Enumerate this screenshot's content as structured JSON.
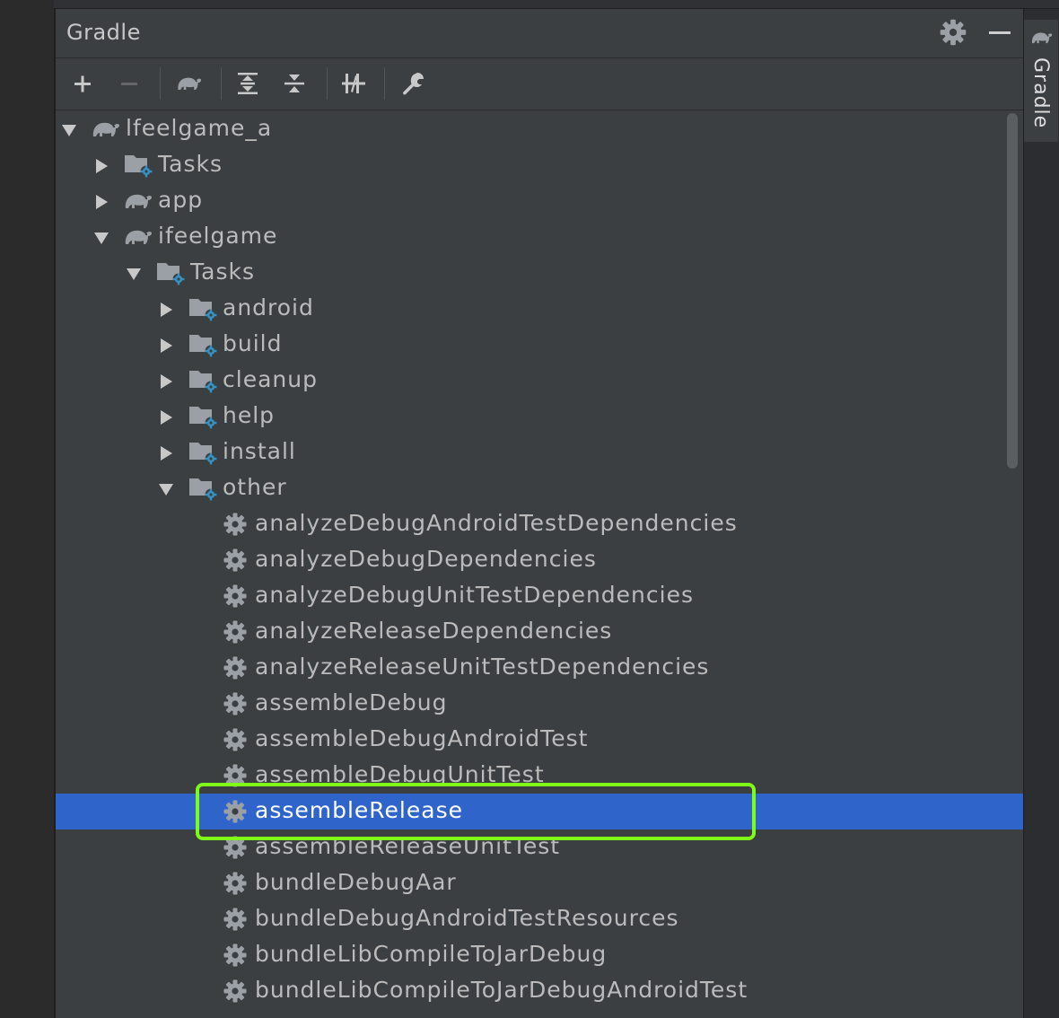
{
  "panel": {
    "title": "Gradle"
  },
  "toolbar": {
    "buttons": [
      {
        "name": "add-icon"
      },
      {
        "name": "remove-icon"
      },
      {
        "name": "gradle-elephant-icon"
      },
      {
        "name": "expand-all-icon"
      },
      {
        "name": "collapse-all-icon"
      },
      {
        "name": "toggle-offline-icon"
      },
      {
        "name": "wrench-icon"
      }
    ]
  },
  "side_tab": {
    "label": "Gradle"
  },
  "tree": {
    "root": "lfeelgame_a",
    "root_tasks": "Tasks",
    "app": "app",
    "module": "ifeelgame",
    "module_tasks": "Tasks",
    "groups": [
      "android",
      "build",
      "cleanup",
      "help",
      "install",
      "other"
    ],
    "tasks": [
      "analyzeDebugAndroidTestDependencies",
      "analyzeDebugDependencies",
      "analyzeDebugUnitTestDependencies",
      "analyzeReleaseDependencies",
      "analyzeReleaseUnitTestDependencies",
      "assembleDebug",
      "assembleDebugAndroidTest",
      "assembleDebugUnitTest",
      "assembleRelease",
      "assembleReleaseUnitTest",
      "bundleDebugAar",
      "bundleDebugAndroidTestResources",
      "bundleLibCompileToJarDebug",
      "bundleLibCompileToJarDebugAndroidTest"
    ],
    "selected_task": "assembleRelease"
  },
  "colors": {
    "panel_bg": "#3c3f41",
    "selection": "#2f65ca",
    "highlight_box": "#7cfc16",
    "folder_badge": "#3592c4"
  }
}
